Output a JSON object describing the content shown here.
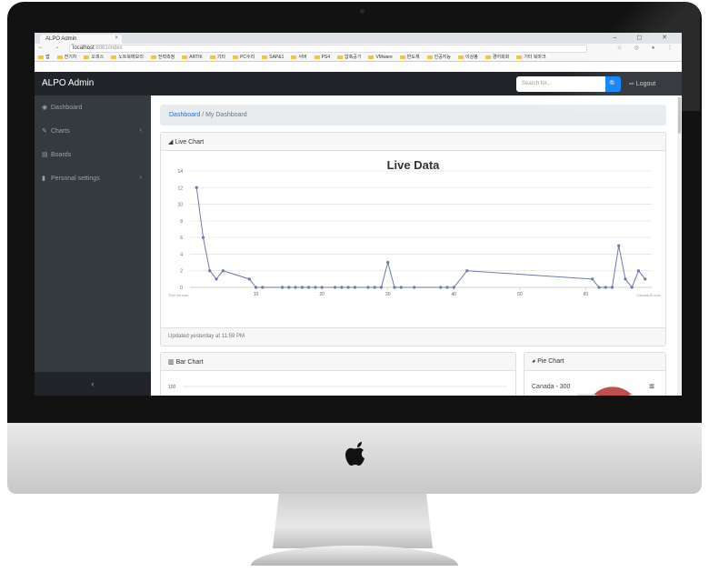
{
  "browser": {
    "tab_title": "ALPO Admin",
    "tab_close": "×",
    "window_controls": "– ◻ ✕",
    "nav_buttons": "← → C ⌂",
    "url_host": "localhost",
    "url_rest": ":8081/index",
    "extensions": "☆ ◎ ● ⋮",
    "bookmarks": [
      "앱",
      "전기차",
      "오피스",
      "노트북메모리",
      "전력측정",
      "ARTIK",
      "기타",
      "PC수리",
      "SAP&1",
      "서버",
      "PS4",
      "압축공기",
      "VMware",
      "반도체",
      "인공지능",
      "이상봉",
      "경어회화",
      "기타 북마크"
    ]
  },
  "app": {
    "brand": "ALPO Admin",
    "search_placeholder": "Search for...",
    "search_icon": "🔍",
    "logout": "⇨ Logout"
  },
  "sidebar": {
    "items": [
      {
        "label": "Dashboard",
        "icon": "dashboard-icon",
        "glyph": "◉",
        "chevron": ""
      },
      {
        "label": "Charts",
        "icon": "wrench-icon",
        "glyph": "✎",
        "chevron": "‹"
      },
      {
        "label": "Boards",
        "icon": "table-icon",
        "glyph": "▤",
        "chevron": ""
      },
      {
        "label": "Personal settings",
        "icon": "file-icon",
        "glyph": "▮",
        "chevron": "‹"
      }
    ],
    "toggle": "‹"
  },
  "breadcrumb": {
    "link": "Dashboard",
    "separator": " / ",
    "current": "My Dashboard"
  },
  "live_card": {
    "header_icon": "◢",
    "header": "Live Chart",
    "title": "Live Data",
    "trial_label": "Trial Version",
    "credit": "CanvasJS.com",
    "footer": "Updated yesterday at 11:59 PM"
  },
  "bar_card": {
    "header_icon": "▥",
    "header": "Bar Chart",
    "y_tick": "100"
  },
  "pie_card": {
    "header_icon": "◕",
    "header": "Pie Chart",
    "label": "Canada - 300",
    "menu": "≡"
  },
  "colors": {
    "line": "#6d78ad",
    "sidebar": "#343a40",
    "topbar": "#212529",
    "primary": "#007bff"
  },
  "chart_data": {
    "type": "line",
    "title": "Live Data",
    "xlim": [
      0,
      70
    ],
    "ylim": [
      0,
      14
    ],
    "x_ticks": [
      10,
      20,
      30,
      40,
      50,
      60
    ],
    "y_ticks": [
      0,
      2,
      4,
      6,
      8,
      10,
      12,
      14
    ],
    "grid": true,
    "series": [
      {
        "x": [
          1,
          2,
          3,
          4,
          5,
          9,
          10,
          11,
          14,
          15,
          16,
          17,
          18,
          19,
          20,
          22,
          23,
          24,
          25,
          27,
          28,
          29,
          30,
          31,
          32,
          34,
          38,
          39,
          40,
          42,
          61,
          62,
          63,
          64,
          65,
          66,
          67,
          68,
          69
        ],
        "y": [
          12,
          6,
          2,
          1,
          2,
          1,
          0,
          0,
          0,
          0,
          0,
          0,
          0,
          0,
          0,
          0,
          0,
          0,
          0,
          0,
          0,
          0,
          3,
          0,
          0,
          0,
          0,
          0,
          0,
          2,
          1,
          0,
          0,
          0,
          5,
          1,
          0,
          2,
          1
        ]
      }
    ]
  }
}
